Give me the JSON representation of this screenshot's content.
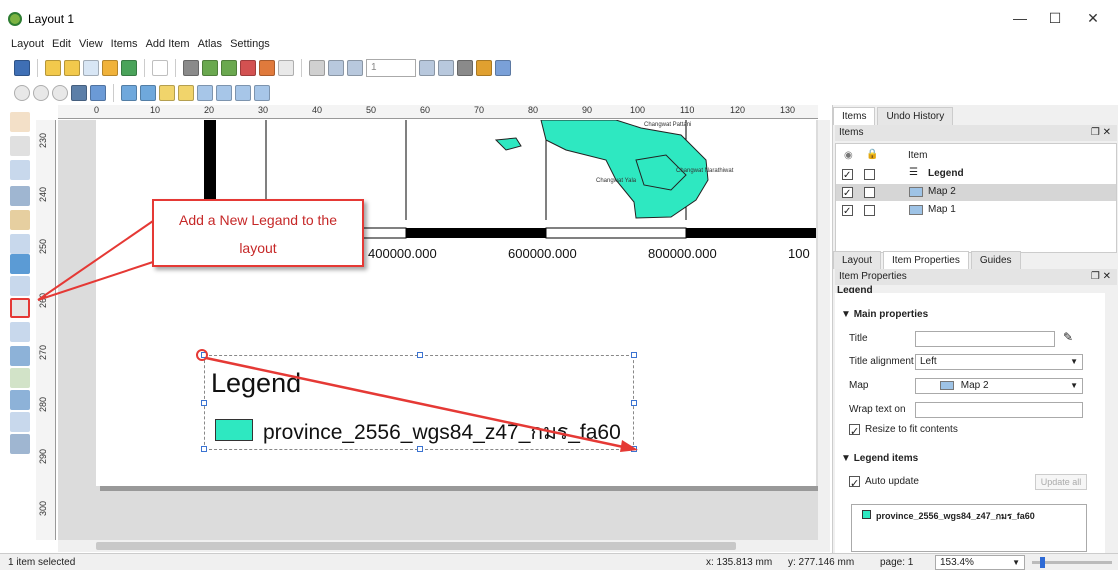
{
  "window": {
    "title": "Layout 1"
  },
  "menu": [
    "Layout",
    "Edit",
    "View",
    "Items",
    "Add Item",
    "Atlas",
    "Settings"
  ],
  "toolbar": {
    "page_value": "1"
  },
  "ruler_top": [
    "0",
    "10",
    "20",
    "30",
    "40",
    "50",
    "60",
    "70",
    "80",
    "90",
    "100",
    "110",
    "120",
    "130"
  ],
  "ruler_left": [
    "230",
    "240",
    "250",
    "260",
    "270",
    "280",
    "290",
    "300"
  ],
  "map": {
    "labels": [
      "Changwat Pattani",
      "Changwat Yala",
      "Changwat Narathiwat"
    ],
    "scale_labels": [
      "400000.000",
      "600000.000",
      "800000.000",
      "100"
    ],
    "land_color": "#2ee8c1"
  },
  "legend": {
    "title": "Legend",
    "item_label": "province_2556_wgs84_z47_กมร_fa60",
    "swatch_color": "#2ee8c1"
  },
  "callout": {
    "line1": "Add a New Legand to the",
    "line2": "layout",
    "color": "#e53935"
  },
  "right": {
    "tabs_top": [
      "Items",
      "Undo History"
    ],
    "items_panel_title": "Items",
    "items_header": "Item",
    "items": [
      {
        "label": "Legend",
        "checked": true,
        "bold": true
      },
      {
        "label": "Map 2",
        "checked": true,
        "bold": false
      },
      {
        "label": "Map 1",
        "checked": true,
        "bold": false
      }
    ],
    "tabs_bottom": [
      "Layout",
      "Item Properties",
      "Guides"
    ],
    "props_panel_title": "Item Properties",
    "props_subtitle": "Legend",
    "main_properties": "Main properties",
    "title_label": "Title",
    "title_value": "",
    "title_alignment_label": "Title alignment",
    "title_alignment_value": "Left",
    "map_label": "Map",
    "map_value": "Map 2",
    "wrap_label": "Wrap text on",
    "resize_label": "Resize to fit contents",
    "legend_items": "Legend items",
    "auto_update_label": "Auto update",
    "update_all_label": "Update all",
    "legend_entry": "province_2556_wgs84_z47_กมร_fa60"
  },
  "status": {
    "left": "1 item selected",
    "x": "x: 135.813 mm",
    "y": "y: 277.146 mm",
    "page": "page: 1",
    "zoom": "153.4%"
  }
}
